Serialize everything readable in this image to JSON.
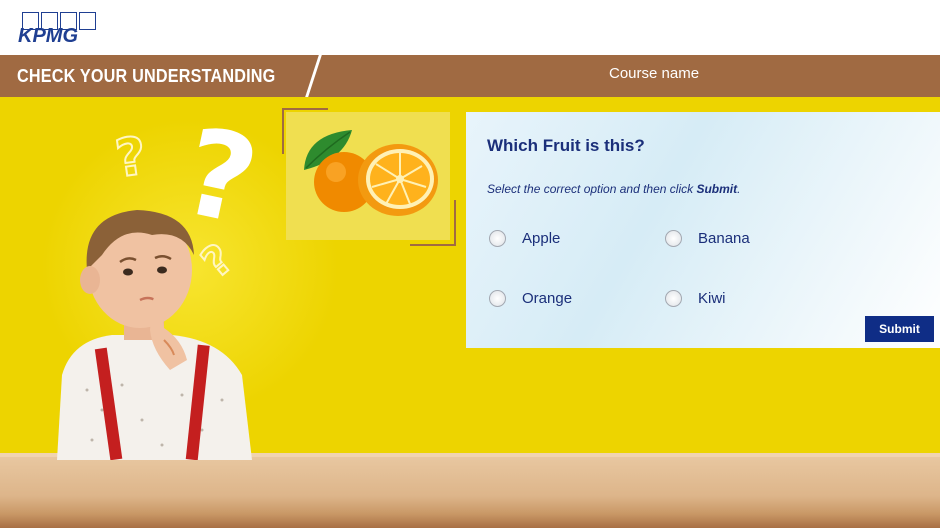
{
  "header": {
    "logo_text": "KPMG",
    "section_title": "CHECK YOUR UNDERSTANDING",
    "course_name": "Course name"
  },
  "question": {
    "title": "Which Fruit is this?",
    "instruction_prefix": "Select the correct option and then click ",
    "instruction_action": "Submit",
    "instruction_suffix": ".",
    "options": [
      "Apple",
      "Banana",
      "Orange",
      "Kiwi"
    ],
    "selected": null
  },
  "actions": {
    "submit_label": "Submit"
  },
  "image": {
    "subject": "orange-fruit"
  },
  "colors": {
    "brand_blue": "#1f3f92",
    "title_bar_brown": "#a06a42",
    "stage_yellow": "#edd400",
    "submit_navy": "#0f2d86",
    "text_navy": "#1b2f7a"
  }
}
